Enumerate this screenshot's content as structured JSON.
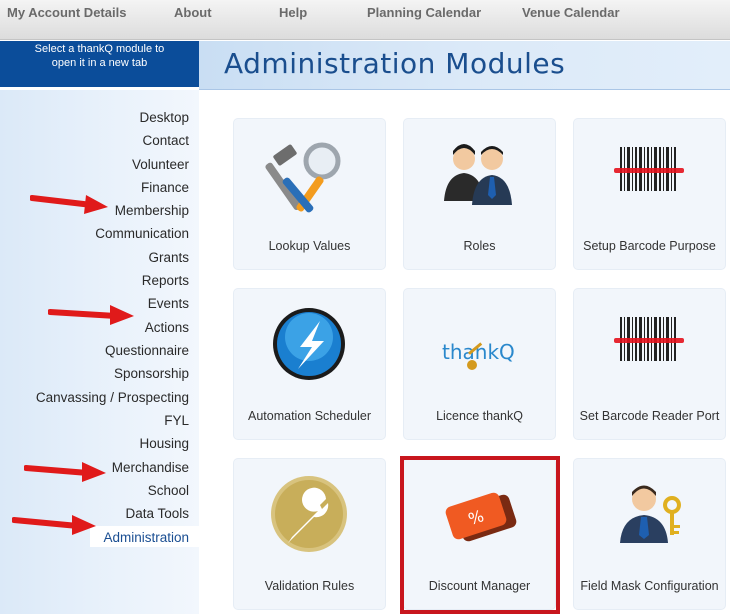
{
  "topbar": {
    "items": [
      {
        "label": "My Account Details"
      },
      {
        "label": "About"
      },
      {
        "label": "Help"
      },
      {
        "label": "Planning Calendar"
      },
      {
        "label": "Venue Calendar"
      }
    ]
  },
  "module_hint": {
    "line1": "Select a thankQ module to",
    "line2": "open it in a new tab"
  },
  "page": {
    "title": "Administration Modules"
  },
  "sidebar": {
    "items": [
      {
        "label": "Desktop"
      },
      {
        "label": "Contact"
      },
      {
        "label": "Volunteer"
      },
      {
        "label": "Finance"
      },
      {
        "label": "Membership"
      },
      {
        "label": "Communication"
      },
      {
        "label": "Grants"
      },
      {
        "label": "Reports"
      },
      {
        "label": "Events"
      },
      {
        "label": "Actions"
      },
      {
        "label": "Questionnaire"
      },
      {
        "label": "Sponsorship"
      },
      {
        "label": "Canvassing / Prospecting"
      },
      {
        "label": "FYL"
      },
      {
        "label": "Housing"
      },
      {
        "label": "Merchandise"
      },
      {
        "label": "School"
      },
      {
        "label": "Data Tools"
      },
      {
        "label": "Administration"
      }
    ],
    "active": "Administration"
  },
  "tiles": [
    {
      "label": "Lookup Values",
      "icon": "tools-magnifier-icon"
    },
    {
      "label": "Roles",
      "icon": "users-icon"
    },
    {
      "label": "Setup Barcode Purpose",
      "icon": "barcode-icon"
    },
    {
      "label": "Automation Scheduler",
      "icon": "lightning-globe-icon"
    },
    {
      "label": "Licence thankQ",
      "icon": "thankq-key-icon",
      "logo_text": "thankQ"
    },
    {
      "label": "Set Barcode Reader Port",
      "icon": "barcode-icon"
    },
    {
      "label": "Validation Rules",
      "icon": "wrench-icon"
    },
    {
      "label": "Discount Manager",
      "icon": "discount-tag-icon",
      "badge_text": "%"
    },
    {
      "label": "Field Mask Configuration",
      "icon": "user-key-icon"
    }
  ],
  "colors": {
    "highlight_border": "#c8161d",
    "arrow": "#e01a1a",
    "title": "#1a4e8e",
    "hint_bg": "#0b4d9a"
  }
}
